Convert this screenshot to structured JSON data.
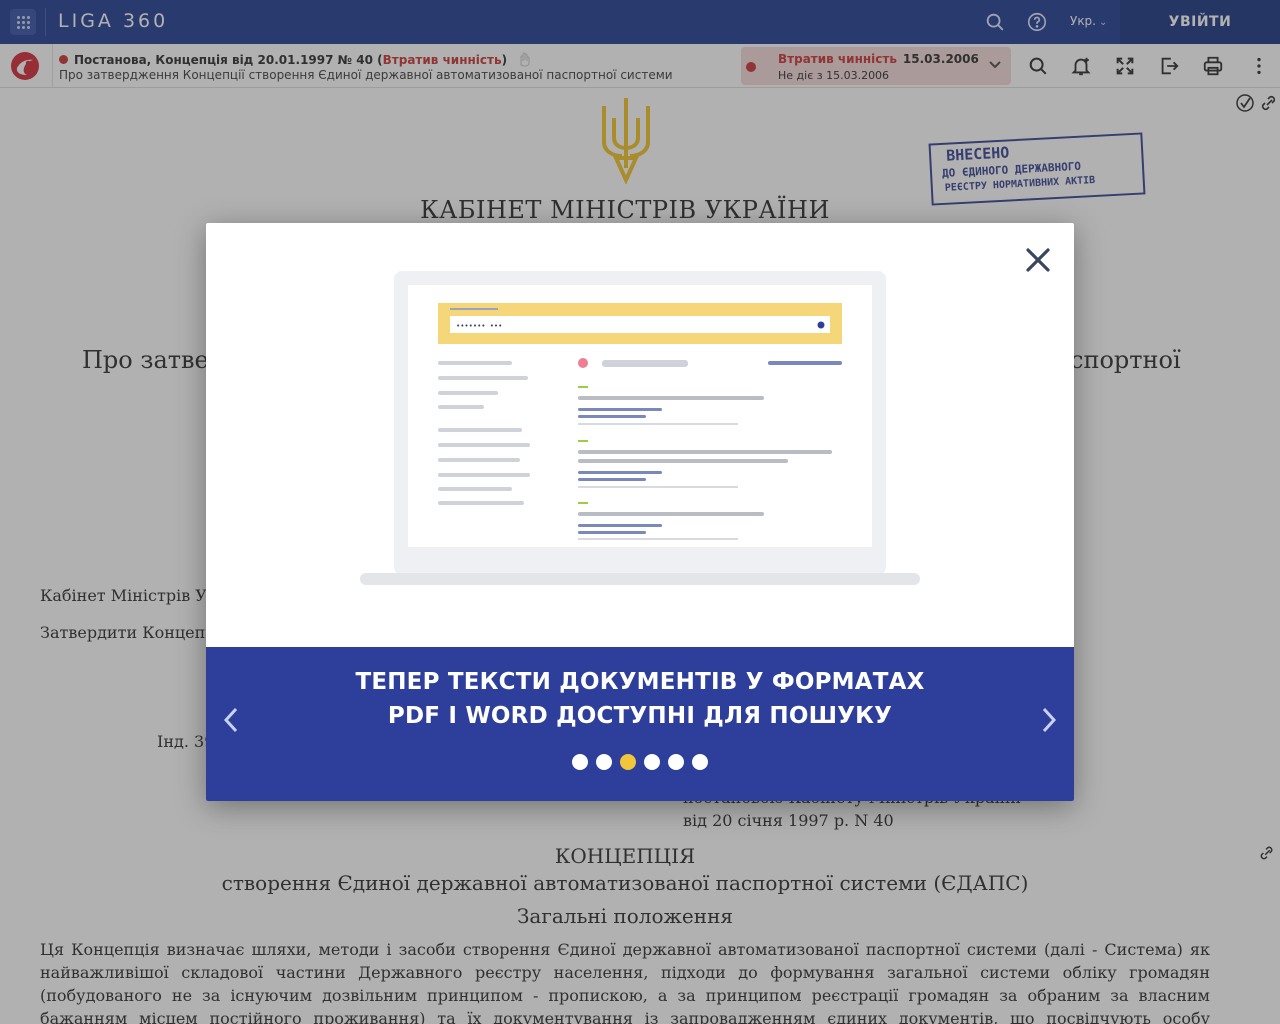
{
  "topbar": {
    "logo": "LIGA 360",
    "language": "Укр.",
    "login_label": "УВІЙТИ",
    "icons": [
      "apps-grid-icon",
      "search-icon",
      "help-icon",
      "chevron-down-icon"
    ]
  },
  "docbar": {
    "doc_type": "Постанова, Концепція від 20.01.1997 № 40",
    "status_inline": "Втратив чинність",
    "doc_title": "Про затвердження Концепції створення Єдиної державної автоматизованої паспортної системи",
    "status_label": "Втратив чинність",
    "status_date": "15.03.2006",
    "status_note": "Не діє з 15.03.2006",
    "icons": [
      "search-icon",
      "bell-add-icon",
      "fullscreen-icon",
      "export-icon",
      "print-icon",
      "more-icon"
    ],
    "colors": {
      "status_red": "#c62828",
      "status_bg": "#f5d8d8"
    }
  },
  "document": {
    "authority": "КАБІНЕТ МІНІСТРІВ УКРАЇНИ",
    "stamp": {
      "line1": "ВНЕСЕНО",
      "line2": "ДО ЄДИНОГО ДЕРЖАВНОГО",
      "line3": "РЕЄСТРУ НОРМАТИВНИХ АКТІВ"
    },
    "title_left": "Про затвер",
    "title_right": "спортної",
    "para1": "Кабінет Міністрів Укр",
    "para2": "Затвердити Концепці",
    "ind": "Інд. 39",
    "approved_line1": "постановою Кабінету Міністрів України",
    "approved_line2": "від 20 січня 1997 р. N 40",
    "concept_heading": "КОНЦЕПЦІЯ",
    "concept_sub": "створення Єдиної державної автоматизованої паспортної системи (ЄДАПС)",
    "section_heading": "Загальні положення",
    "body_text": "Ця Концепція визначає шляхи, методи і засоби створення Єдиної державної автоматизованої паспортної системи (далі - Система) як найважливішої складової частини Державного реєстру населення, підходи до формування загальної системи обліку громадян (побудованого не за існуючим дозвільним принципом - пропискою, а за принципом реєстрації громадян за обраним за власним бажанням місцем постійного проживання) та їх документування із запровадженням єдиних документів, що посвідчують особу громадянина України - паспортів, а також"
  },
  "modal": {
    "search_mock_text": "•••••••  •••",
    "banner_line1": "ТЕПЕР ТЕКСТИ ДОКУМЕНТІВ У ФОРМАТАХ",
    "banner_line2": "PDF І WORD ДОСТУПНІ ДЛЯ ПОШУКУ",
    "slides_total": 6,
    "active_slide": 3,
    "colors": {
      "banner": "#2e3f9b",
      "active_dot": "#f3c53a",
      "mock_header": "#f5d77a"
    }
  }
}
